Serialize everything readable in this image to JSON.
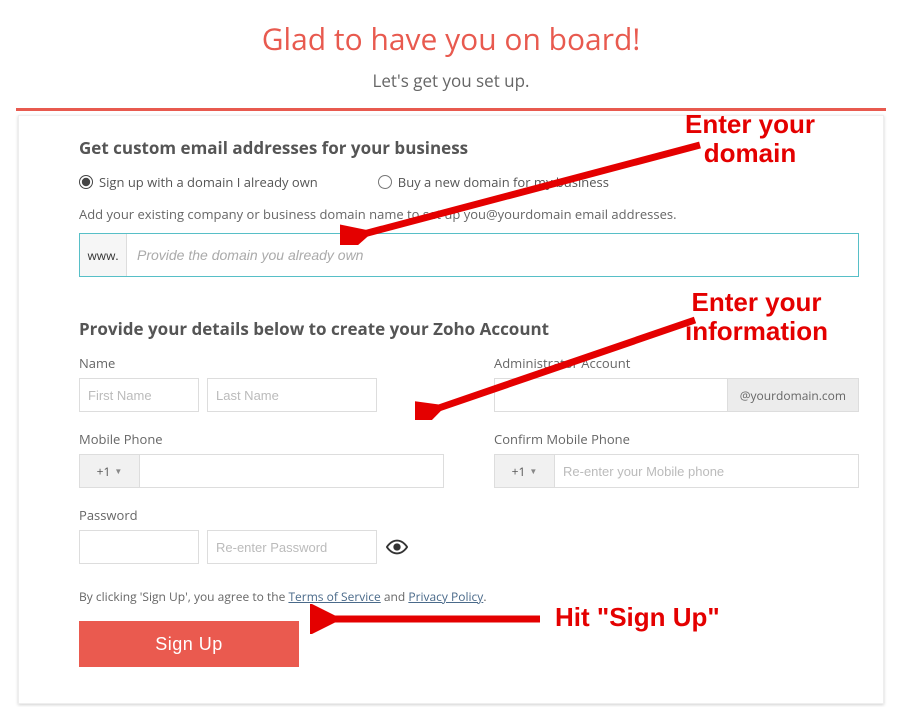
{
  "header": {
    "title": "Glad to have you on board!",
    "subtitle": "Let's get you set up."
  },
  "section1": {
    "title": "Get custom email addresses for your business",
    "radio_own": "Sign up with a domain I already own",
    "radio_buy": "Buy a new domain for my business",
    "help": "Add your existing company or business domain name to set up you@yourdomain email addresses.",
    "prefix": "www.",
    "placeholder": "Provide the domain you already own"
  },
  "section2": {
    "title": "Provide your details below to create your Zoho Account",
    "name_label": "Name",
    "first_ph": "First Name",
    "last_ph": "Last Name",
    "admin_label": "Administrator Account",
    "admin_suffix": "@yourdomain.com",
    "mobile_label": "Mobile Phone",
    "confirm_mobile_label": "Confirm Mobile Phone",
    "confirm_mobile_ph": "Re-enter your Mobile phone",
    "phone_code": "+1",
    "password_label": "Password",
    "pw2_ph": "Re-enter Password"
  },
  "terms": {
    "prefix": "By clicking 'Sign Up', you agree to the ",
    "tos": "Terms of Service",
    "mid": " and ",
    "pp": "Privacy Policy",
    "suffix": "."
  },
  "signup_label": "Sign Up",
  "annotations": {
    "a1_l1": "Enter your",
    "a1_l2": "domain",
    "a2_l1": "Enter your",
    "a2_l2": "information",
    "a3": "Hit \"Sign Up\""
  }
}
